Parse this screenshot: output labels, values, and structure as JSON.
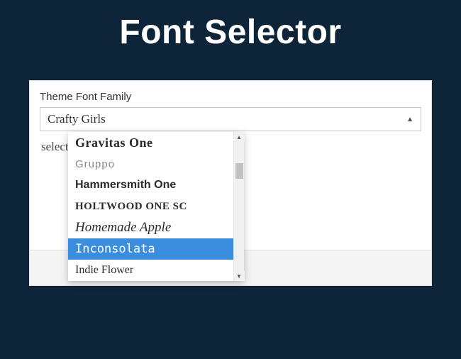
{
  "title": "Font Selector",
  "field": {
    "label": "Theme Font Family",
    "selected_value": "Crafty Girls",
    "arrow_glyph": "▲"
  },
  "helper_text_suffix": "selected",
  "dropdown": {
    "options": [
      {
        "label": "Gravitas One",
        "style": "f-gravitas",
        "highlighted": false
      },
      {
        "label": "Gruppo",
        "style": "f-gruppo",
        "highlighted": false
      },
      {
        "label": "Hammersmith One",
        "style": "f-hammersmith",
        "highlighted": false
      },
      {
        "label": "Holtwood One SC",
        "style": "f-holtwood",
        "highlighted": false
      },
      {
        "label": "Homemade Apple",
        "style": "f-homemade",
        "highlighted": false
      },
      {
        "label": "Inconsolata",
        "style": "f-inconsolata",
        "highlighted": true
      },
      {
        "label": "Indie Flower",
        "style": "f-indie",
        "highlighted": false
      }
    ],
    "scroll": {
      "up_glyph": "▲",
      "down_glyph": "▼"
    }
  }
}
